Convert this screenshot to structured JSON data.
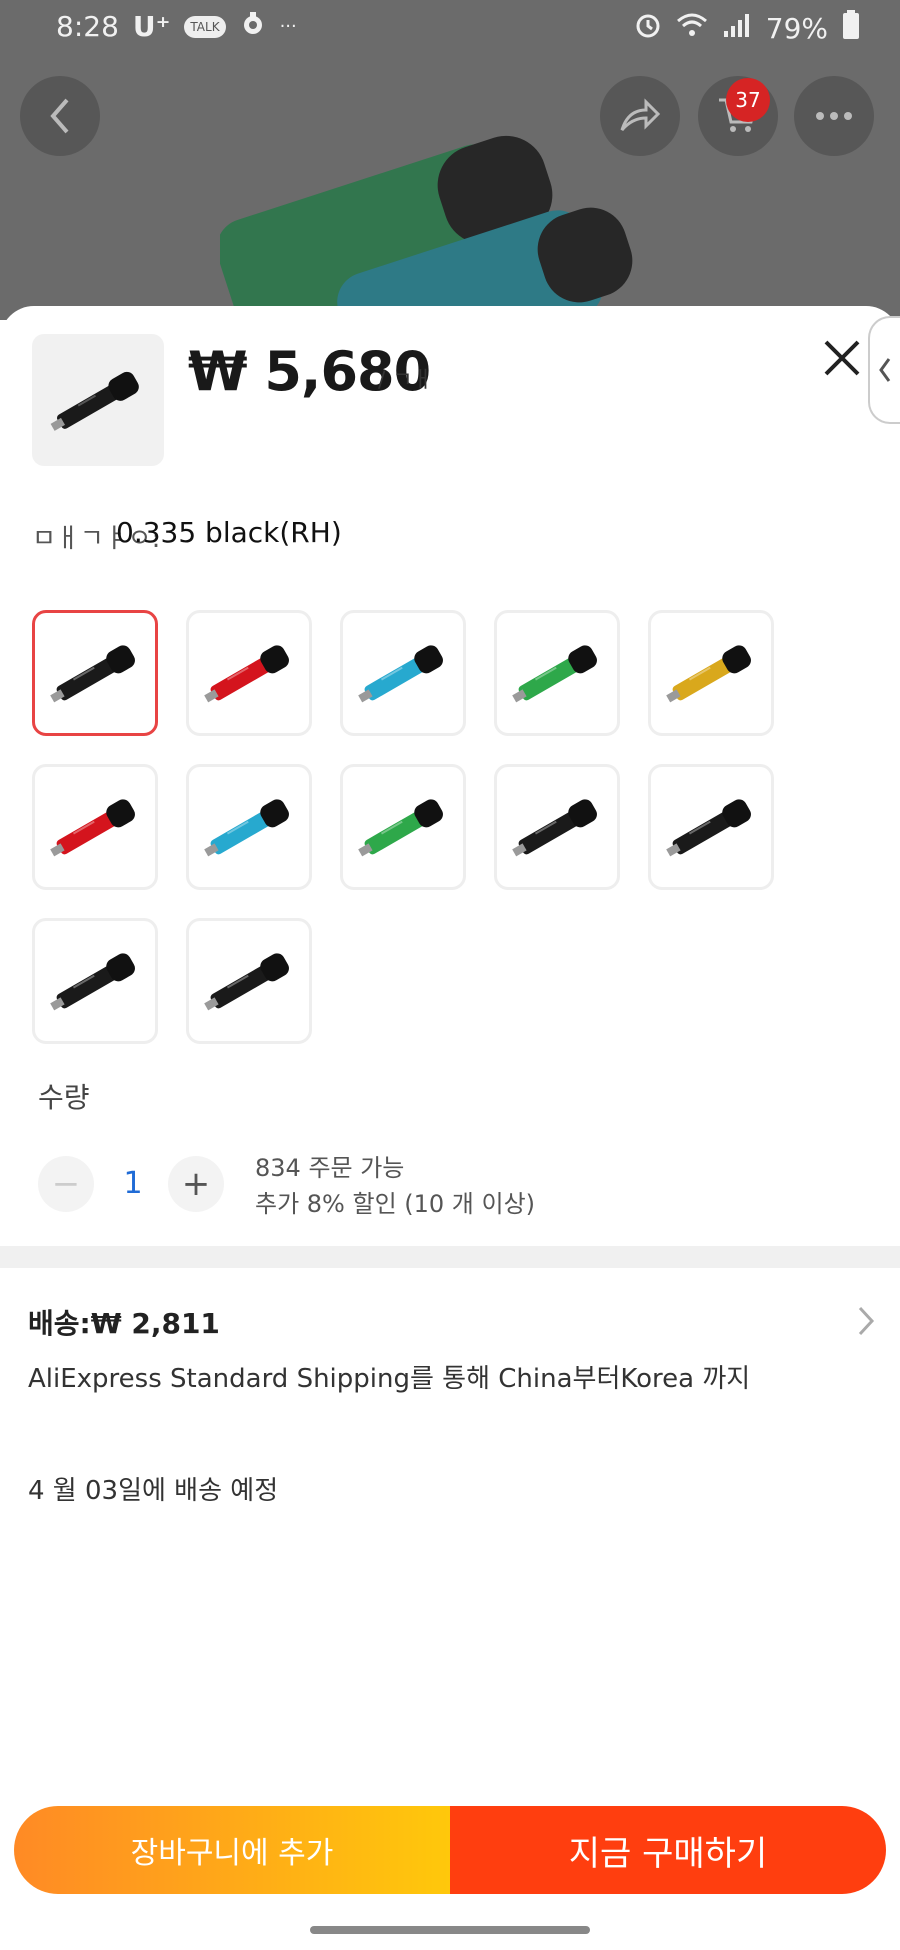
{
  "status_bar": {
    "time": "8:28",
    "carrier": "U⁺",
    "talk_badge": "TALK",
    "dots": "···",
    "battery": "79%"
  },
  "top_nav": {
    "cart_count": "37"
  },
  "sheet": {
    "price": "₩ 5,680",
    "unit": "/ ㄱㅐ",
    "color_label": "ㅁㅐㄱㅑㅇ:",
    "color_value": "0.335 black(RH)",
    "swatches": [
      {
        "color": "#1a1a1a"
      },
      {
        "color": "#d4141d"
      },
      {
        "color": "#27a9cf"
      },
      {
        "color": "#2ea84a"
      },
      {
        "color": "#d9a81c"
      },
      {
        "color": "#d4141d"
      },
      {
        "color": "#27a9cf"
      },
      {
        "color": "#2ea84a"
      },
      {
        "color": "#1a1a1a"
      },
      {
        "color": "#1a1a1a"
      },
      {
        "color": "#1a1a1a"
      },
      {
        "color": "#1a1a1a"
      }
    ],
    "quantity_label": "수량",
    "quantity_value": "1",
    "quantity_minus": "−",
    "quantity_plus": "+",
    "available": "834 주문 가능",
    "discount": "추가 8% 할인 (10 개 이상)",
    "shipping_title": "배송:₩ 2,811",
    "shipping_desc": "AliExpress Standard Shipping를 통해 China부터Korea 까지",
    "delivery_date": "4 월 03일에 배송 예정"
  },
  "actions": {
    "add_to_cart": "장바구니에 추가",
    "buy_now": "지금 구매하기"
  },
  "colors": {
    "accent": "#ff3e0f",
    "accent_gradient_start": "#ff8a25",
    "accent_gradient_end": "#ffc80b",
    "selected_border": "#e84444",
    "badge": "#d62424"
  }
}
